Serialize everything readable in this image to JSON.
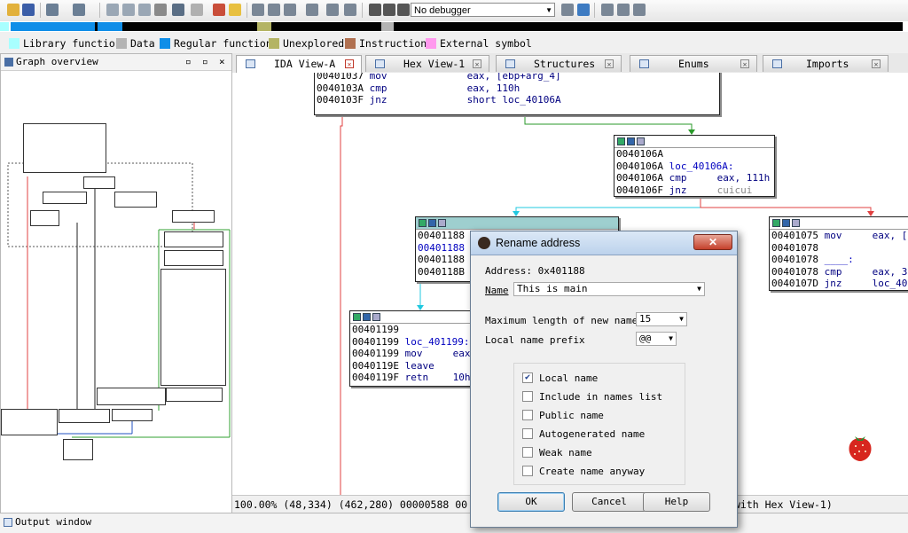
{
  "toolbar": {
    "debugger": "No debugger"
  },
  "legend": [
    {
      "label": "Library function",
      "color": "#a8ffff"
    },
    {
      "label": "Data",
      "color": "#b4b4b4"
    },
    {
      "label": "Regular function",
      "color": "#0f8ee8"
    },
    {
      "label": "Unexplored",
      "color": "#b4b464"
    },
    {
      "label": "Instruction",
      "color": "#b07050"
    },
    {
      "label": "External symbol",
      "color": "#ff99ee"
    }
  ],
  "graph_overview": {
    "title": "Graph overview",
    "controls": [
      "▫",
      "▫",
      "×"
    ]
  },
  "tabs": [
    {
      "label": "IDA View-A",
      "active": true
    },
    {
      "label": "Hex View-1"
    },
    {
      "label": "Structures"
    },
    {
      "label": "Enums"
    },
    {
      "label": "Imports"
    }
  ],
  "nodes": {
    "top": [
      {
        "a": "00401037",
        "m": "mov",
        "o": "eax, [ebp+arg_4]"
      },
      {
        "a": "0040103A",
        "m": "cmp",
        "o": "eax, 110h"
      },
      {
        "a": "0040103F",
        "m": "jnz",
        "o": "short loc_40106A"
      }
    ],
    "loc_40106A": [
      {
        "a": "0040106A",
        "m": "",
        "o": ""
      },
      {
        "a": "0040106A",
        "m": "loc_40106A:",
        "o": ""
      },
      {
        "a": "0040106A",
        "m": "cmp",
        "o": "eax, 111h"
      },
      {
        "a": "0040106F",
        "m": "jnz",
        "o": "cuicui"
      }
    ],
    "right": [
      {
        "a": "00401075",
        "m": "mov",
        "o": "eax, ["
      },
      {
        "a": "00401078",
        "m": "",
        "o": ""
      },
      {
        "a": "00401078",
        "m": "____:",
        "o": ""
      },
      {
        "a": "00401078",
        "m": "cmp",
        "o": "eax, 3"
      },
      {
        "a": "0040107D",
        "m": "jnz",
        "o": "loc_40"
      }
    ],
    "mid": [
      "00401188",
      "00401188",
      "00401188",
      "0040118B"
    ],
    "loc_401199": [
      {
        "a": "00401199",
        "m": "",
        "o": ""
      },
      {
        "a": "00401199",
        "m": "loc_401199:",
        "o": ""
      },
      {
        "a": "00401199",
        "m": "mov",
        "o": "eax"
      },
      {
        "a": "0040119E",
        "m": "leave",
        "o": ""
      },
      {
        "a": "0040119F",
        "m": "retn",
        "o": "10h"
      }
    ]
  },
  "status_line": "100.00% (48,334) (462,280) 00000588 00",
  "status_line_tail": "with Hex View-1)",
  "output_window": {
    "title": "Output window"
  },
  "dialog": {
    "title": "Rename address",
    "address": "Address: 0x401188",
    "name_label": "Name",
    "name_value": "This is main",
    "maxlen_label": "Maximum length of new names",
    "maxlen_value": "15",
    "prefix_label": "Local name prefix",
    "prefix_value": "@@",
    "options": [
      {
        "label": "Local name",
        "checked": true
      },
      {
        "label": "Include in names list",
        "checked": false
      },
      {
        "label": "Public name",
        "checked": false
      },
      {
        "label": "Autogenerated name",
        "checked": false
      },
      {
        "label": "Weak name",
        "checked": false
      },
      {
        "label": "Create name anyway",
        "checked": false
      }
    ],
    "buttons": {
      "ok": "OK",
      "cancel": "Cancel",
      "help": "Help"
    }
  }
}
